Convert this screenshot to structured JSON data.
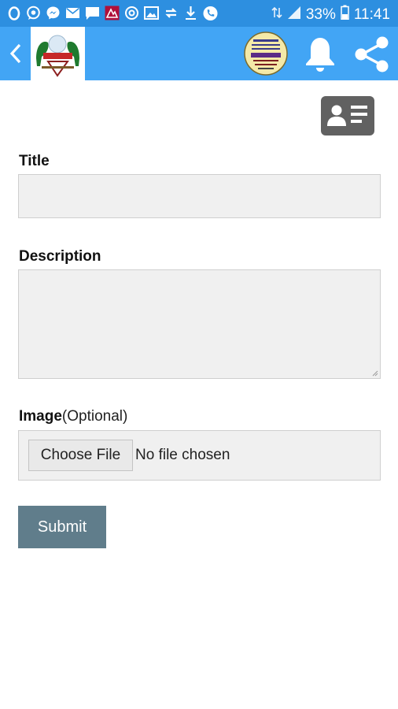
{
  "status_bar": {
    "battery_percent": "33%",
    "time": "11:41",
    "left_icons": [
      "opera-icon",
      "whatsapp-icon",
      "messenger-icon",
      "mail-icon",
      "chat-icon",
      "app-icon",
      "at-icon",
      "gallery-icon",
      "sync-icon",
      "download-icon",
      "phone-icon"
    ],
    "colors": {
      "background": "#2d8fe0"
    }
  },
  "app_bar": {
    "colors": {
      "background": "#42a5f5"
    },
    "icons": [
      "back-arrow-icon",
      "app-logo",
      "partner-logo",
      "bell-icon",
      "share-icon"
    ]
  },
  "form": {
    "title_label": "Title",
    "title_value": "",
    "description_label": "Description",
    "description_value": "",
    "image_label": "Image",
    "image_optional": "(Optional)",
    "choose_file_label": "Choose File",
    "file_status": "No file chosen",
    "submit_label": "Submit",
    "colors": {
      "submit": "#607d8b",
      "field": "#f0f0f0",
      "contact_button": "#616161"
    }
  }
}
